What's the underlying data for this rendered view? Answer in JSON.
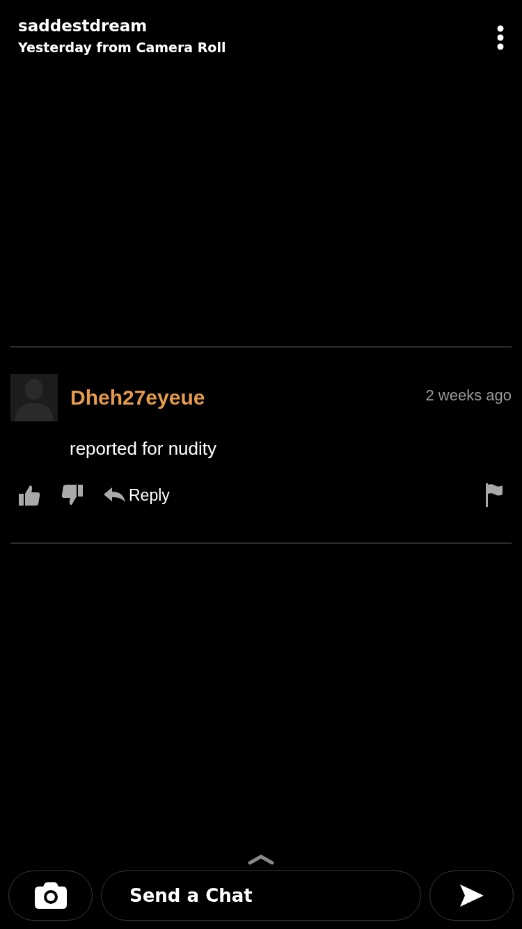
{
  "header": {
    "username": "saddestdream",
    "subtitle": "Yesterday from Camera Roll"
  },
  "comment": {
    "author": "Dheh27eyeue",
    "time": "2 weeks ago",
    "text": "reported for nudity",
    "reply_label": "Reply"
  },
  "chat": {
    "placeholder": "Send a Chat"
  }
}
